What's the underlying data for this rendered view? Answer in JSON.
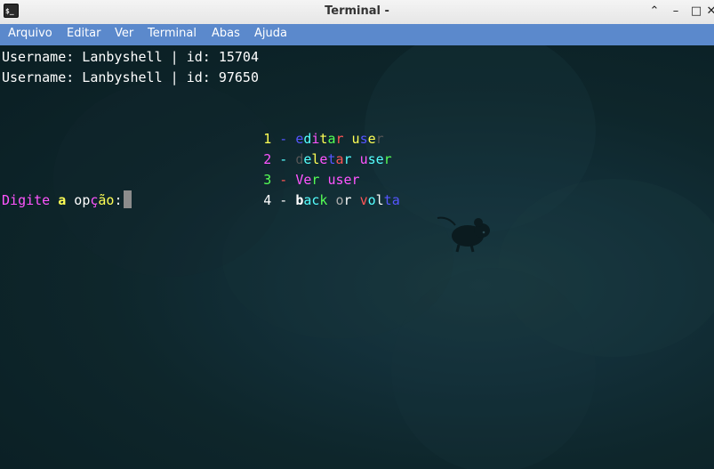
{
  "window": {
    "title": "Terminal -",
    "icon": "terminal-icon"
  },
  "titlebar_buttons": [
    "chevron-up-icon",
    "minimize-icon",
    "maximize-icon",
    "close-icon"
  ],
  "menu": [
    "Arquivo",
    "Editar",
    "Ver",
    "Terminal",
    "Abas",
    "Ajuda"
  ],
  "terminal": {
    "background": "#0d2227",
    "lines": [
      "Username: Lanbyshell | id: 15704",
      "Username: Lanbyshell | id: 97650"
    ],
    "options": [
      {
        "num": "1",
        "sep": " - ",
        "num_color": "#ffff55",
        "sep_color": "#5555ff",
        "segments": [
          {
            "t": "e",
            "c": "#5555ff"
          },
          {
            "t": "d",
            "c": "#55ffff"
          },
          {
            "t": "i",
            "c": "#ff55ff"
          },
          {
            "t": "t",
            "c": "#ffff55"
          },
          {
            "t": "a",
            "c": "#55ff55"
          },
          {
            "t": "r",
            "c": "#ff5555"
          },
          {
            "t": " ",
            "c": "#ffffff"
          },
          {
            "t": "u",
            "c": "#ffff55"
          },
          {
            "t": "s",
            "c": "#5555ff"
          },
          {
            "t": "e",
            "c": "#ffff55"
          },
          {
            "t": "r",
            "c": "#555555"
          }
        ]
      },
      {
        "num": "2",
        "sep": " - ",
        "num_color": "#ff55ff",
        "sep_color": "#55ffff",
        "segments": [
          {
            "t": "d",
            "c": "#555555"
          },
          {
            "t": "e",
            "c": "#55ffff"
          },
          {
            "t": "l",
            "c": "#ffff55"
          },
          {
            "t": "e",
            "c": "#ff55ff"
          },
          {
            "t": "t",
            "c": "#5555ff"
          },
          {
            "t": "a",
            "c": "#ff5555"
          },
          {
            "t": "r",
            "c": "#55ffff"
          },
          {
            "t": " ",
            "c": "#ffffff"
          },
          {
            "t": "u",
            "c": "#ff55ff"
          },
          {
            "t": "s",
            "c": "#55ffff"
          },
          {
            "t": "e",
            "c": "#55ffff"
          },
          {
            "t": "r",
            "c": "#55ff55"
          }
        ]
      },
      {
        "num": "3",
        "sep": " - ",
        "num_color": "#55ff55",
        "sep_color": "#ff5555",
        "segments": [
          {
            "t": "V",
            "c": "#ff55ff"
          },
          {
            "t": "e",
            "c": "#ff55ff"
          },
          {
            "t": "r",
            "c": "#55ff55"
          },
          {
            "t": " ",
            "c": "#ffffff"
          },
          {
            "t": "u",
            "c": "#ff55ff"
          },
          {
            "t": "s",
            "c": "#ff55ff"
          },
          {
            "t": "e",
            "c": "#ff55ff"
          },
          {
            "t": "r",
            "c": "#ff55ff"
          }
        ]
      },
      {
        "num": "4",
        "sep": " - ",
        "num_color": "#ffffff",
        "sep_color": "#ffffff",
        "segments": [
          {
            "t": "b",
            "c": "#ffffff",
            "b": true
          },
          {
            "t": "a",
            "c": "#55ffff"
          },
          {
            "t": "c",
            "c": "#55ffff"
          },
          {
            "t": "k",
            "c": "#55ff55"
          },
          {
            "t": " ",
            "c": "#ffffff"
          },
          {
            "t": "o",
            "c": "#aaaaaa"
          },
          {
            "t": "r",
            "c": "#ffffff"
          },
          {
            "t": " ",
            "c": "#ffffff"
          },
          {
            "t": "v",
            "c": "#ff5555"
          },
          {
            "t": "o",
            "c": "#55ffff"
          },
          {
            "t": "l",
            "c": "#ffffff"
          },
          {
            "t": "t",
            "c": "#5555ff"
          },
          {
            "t": "a",
            "c": "#5555ff"
          }
        ]
      }
    ],
    "prompt_segments": [
      {
        "t": "D",
        "c": "#ff55ff"
      },
      {
        "t": "i",
        "c": "#ff55ff"
      },
      {
        "t": "g",
        "c": "#ff55ff"
      },
      {
        "t": "i",
        "c": "#ff55ff"
      },
      {
        "t": "t",
        "c": "#ff55ff"
      },
      {
        "t": "e",
        "c": "#ff55ff"
      },
      {
        "t": " ",
        "c": "#ffffff"
      },
      {
        "t": "a",
        "c": "#ffff55",
        "b": true
      },
      {
        "t": " ",
        "c": "#ffffff"
      },
      {
        "t": "o",
        "c": "#ffffff"
      },
      {
        "t": "p",
        "c": "#ffffff"
      },
      {
        "t": "ç",
        "c": "#ff55ff"
      },
      {
        "t": "ã",
        "c": "#ffff55"
      },
      {
        "t": "o",
        "c": "#ffff55"
      },
      {
        "t": ":",
        "c": "#ffffff"
      }
    ]
  }
}
